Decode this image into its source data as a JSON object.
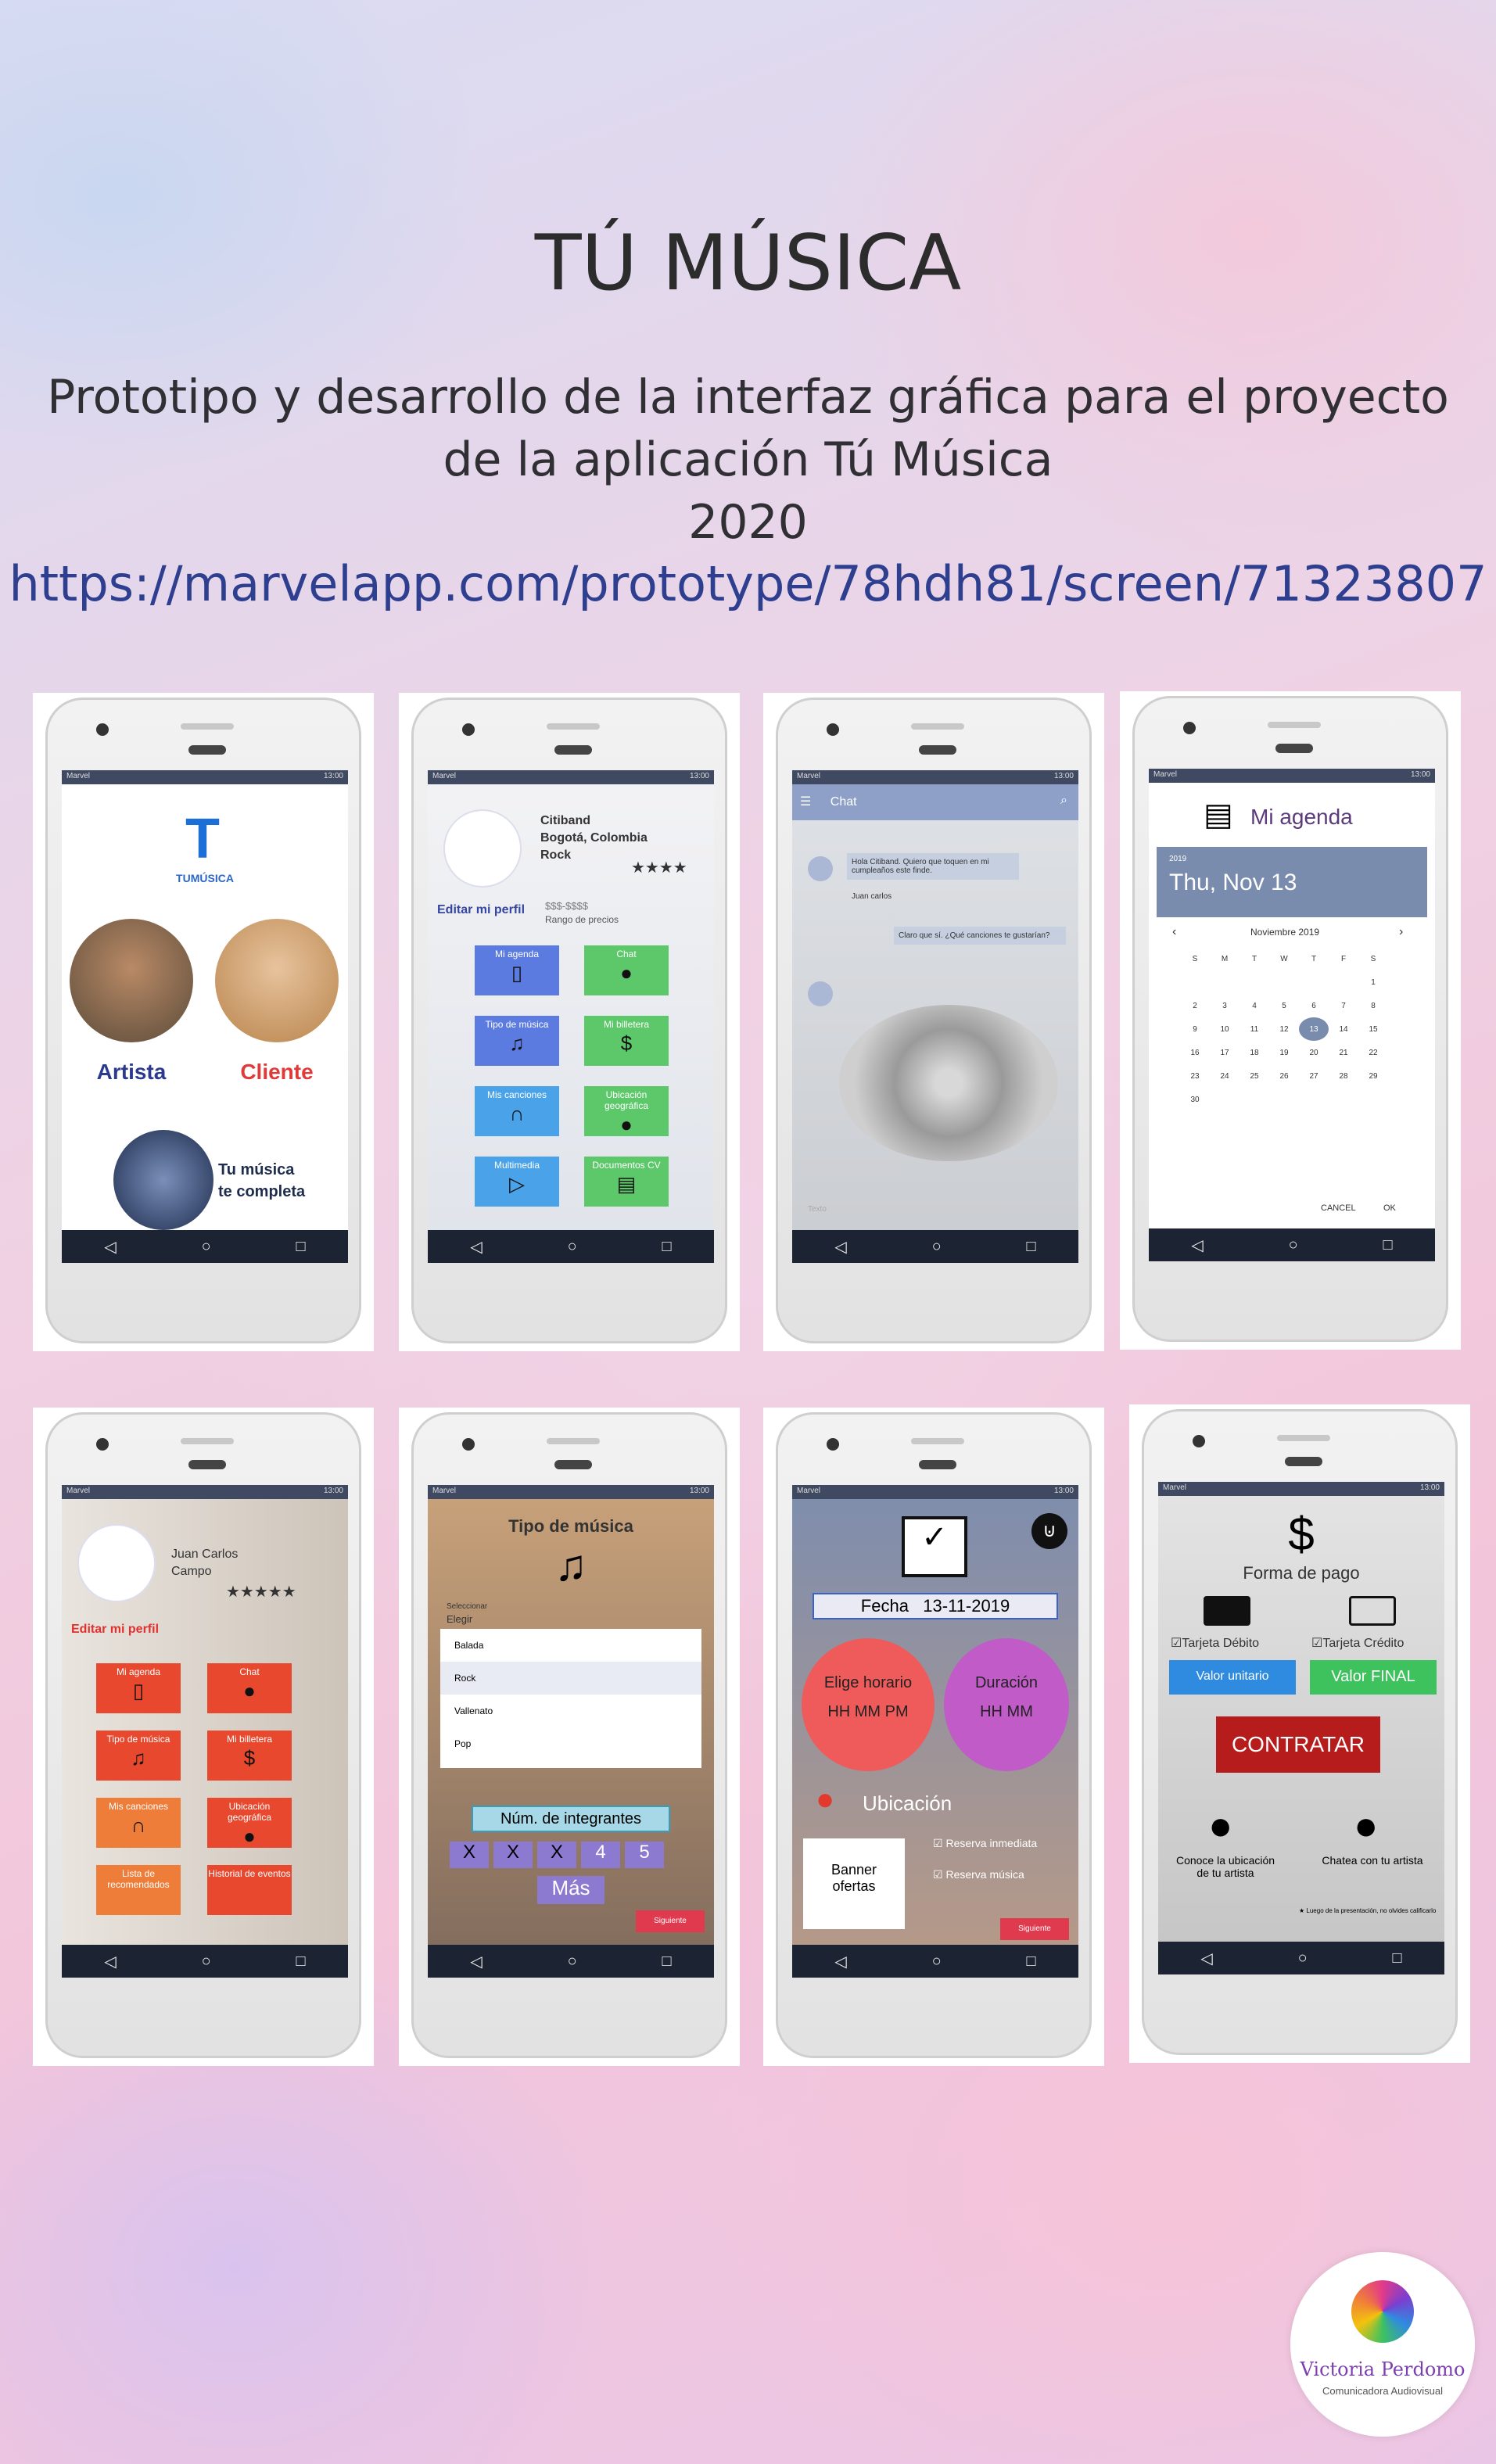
{
  "header": {
    "title": "TÚ MÚSICA",
    "subtitle_line1": "Prototipo y desarrollo de la interfaz gráfica para el proyecto",
    "subtitle_line2": "de la aplicación Tú Música",
    "year": "2020",
    "url": "https://marvelapp.com/prototype/78hdh81/screen/71323807"
  },
  "status": {
    "carrier": "Marvel",
    "time": "13:00"
  },
  "nav": {
    "back": "◁",
    "home": "○",
    "recent": "□"
  },
  "s1": {
    "brand": "TUMÚSICA",
    "artist": "Artista",
    "client": "Cliente",
    "promo_line1": "Tu música",
    "promo_line2": "te completa"
  },
  "s2": {
    "name": "Citiband",
    "city": "Bogotá, Colombia",
    "genre": "Rock",
    "stars": "★★★★",
    "edit": "Editar mi perfil",
    "price": "$$$-$$$$",
    "price_label": "Rango de precios",
    "tiles": [
      "Mi agenda",
      "Chat",
      "Tipo de música",
      "Mi billetera",
      "Mis canciones",
      "Ubicación geográfica",
      "Multimedia",
      "Documentos CV"
    ]
  },
  "s3": {
    "title": "Chat",
    "msg1": "Hola Citiband. Quiero que toquen en mi cumpleaños este finde.",
    "author": "Juan carlos",
    "msg2": "Claro que sí. ¿Qué canciones te gustarían?",
    "input_placeholder": "Texto"
  },
  "s4": {
    "title": "Mi agenda",
    "year": "2019",
    "date": "Thu, Nov 13",
    "month": "Noviembre 2019",
    "days": [
      "S",
      "M",
      "T",
      "W",
      "T",
      "F",
      "S"
    ],
    "cancel": "CANCEL",
    "ok": "OK"
  },
  "s5": {
    "name1": "Juan Carlos",
    "name2": "Campo",
    "stars": "★★★★★",
    "edit": "Editar mi perfil",
    "tiles": [
      "Mi agenda",
      "Chat",
      "Tipo de música",
      "Mi billetera",
      "Mis canciones",
      "Ubicación geográfica",
      "Lista de recomendados",
      "Historial de eventos"
    ]
  },
  "s6": {
    "title": "Tipo de música",
    "select_label": "Seleccionar",
    "select_value": "Elegir",
    "options": [
      "Balada",
      "Rock",
      "Vallenato",
      "Pop"
    ],
    "members_label": "Núm. de integrantes",
    "nums": [
      "X",
      "X",
      "X",
      "4",
      "5"
    ],
    "more": "Más",
    "next": "Siguiente"
  },
  "s7": {
    "date_label": "Fecha",
    "date": "13-11-2019",
    "time_label": "Elige horario",
    "time_value": "HH MM PM",
    "dur_label": "Duración",
    "dur_value": "HH MM",
    "location": "Ubicación",
    "banner": "Banner ofertas",
    "opt1": "Reserva inmediata",
    "opt2": "Reserva música",
    "next": "Siguiente"
  },
  "s8": {
    "title": "Forma de pago",
    "debit": "Tarjeta Débito",
    "credit": "Tarjeta Crédito",
    "unit": "Valor unitario",
    "final": "Valor FINAL",
    "contract": "CONTRATAR",
    "loc": "Conoce la ubicación de tu artista",
    "chat": "Chatea con tu artista",
    "note": "Luego de la presentación, no olvides calificarlo"
  },
  "logo": {
    "name": "Victoria Perdomo",
    "role": "Comunicadora Audiovisual"
  },
  "colors": {
    "tile_blue": "#5b7be0",
    "tile_green": "#5cc86a",
    "tile_red": "#e8492e",
    "tile_orange": "#ef7d3a",
    "url": "#2e3f8f"
  }
}
